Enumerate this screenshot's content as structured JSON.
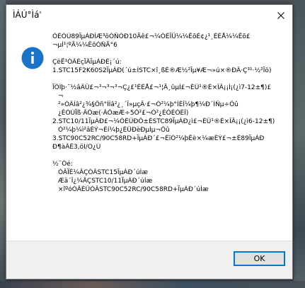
{
  "window": {
    "title": "ÌÁÚ°Ìáʾ"
  },
  "message": {
    "lines": [
      "ÓÉÓÚ89ÏµÁÐÍÆ³öÒÑÓÐ10Äê£¬¼ÓÉÏÜ¼¼ÊõÉ¢¿¹¸ÉÈÅ¼¼Êõ£",
      "¬µÍ¹¦ºÄ¼¼ÊõÒÑÄ°6",
      "",
      "ÇëË¹ÓÃÈçÏÂÏµÁÐÈ¡´ú:",
      "1.STC15F2K60S2ÏµÁÐ(´ú±ÍSTC×î¸ßÈ®Æ½²Ïµ¥Æ¬»ú×®ÐÂ·Ç³¹·½²Ïö)",
      "",
      "ÏÖÌþ·¨½âÃÜ£¬³¬³¬³¬Ç¿£¹ÉÈÅ£¬¹¦Ä¸ûµÍ£¬ÈÜ¹®È×ÎÂ¡¡Ì¡(¿ì7-12±¶)£",
      "¬",
      "²»ÓÃÍâ²¿¾§Õñ°ÍÍâ²¿¸´Î»µçÂ·£¬Ó²¼þ°ÍÈÎ¼þ¶¼Ð´ÌÑµ÷Õû",
      "¿ÉÓÚÏß·ÂÖæ(·ÂÕæÆ÷5Ô²£¬Ò²¿ÉÓÉÓÈÎ)",
      "2.STC10/11ÏµÁÐ£¬¼ÓÈÜÐÔ±ÈSTC89ÏµÁÐ¿ì£¬ÈÜ¹®È×ÎÂ¡¡(¿ì6-12±¶)",
      "Ó²¼þ¼ì²âÈÝ¬Èí¼þ¿ÉÜÐèÐµÌµ¬Õû",
      "3.STC90C52RC/90C58RD+ÏµÁÐ´£¬ÈïÓ²¼þÊè×¼æÈÝ£¬±È89ÏµÁÐ",
      "Ð¶àÃÈ3,öI/O¿Ú",
      "",
      "½¨Òé:",
      "ÒÂÏÈ¼ÂÇÓÃSTC15ÏµÁÐ´úÌæ",
      "Æä´Î¿¼ÂÇSTC10/11ÏµÁÐ´úÌæ",
      "×îºóÓÂÉÛÓÃSTC90C52RC/90C58RD+ÏµÁÐ´úÌæ"
    ]
  },
  "buttons": {
    "ok_label": "OK"
  },
  "icons": {
    "info": "info-icon",
    "close": "close-icon"
  },
  "colors": {
    "info_icon_bg": "#1a73c8",
    "ok_border": "#0078d7"
  }
}
